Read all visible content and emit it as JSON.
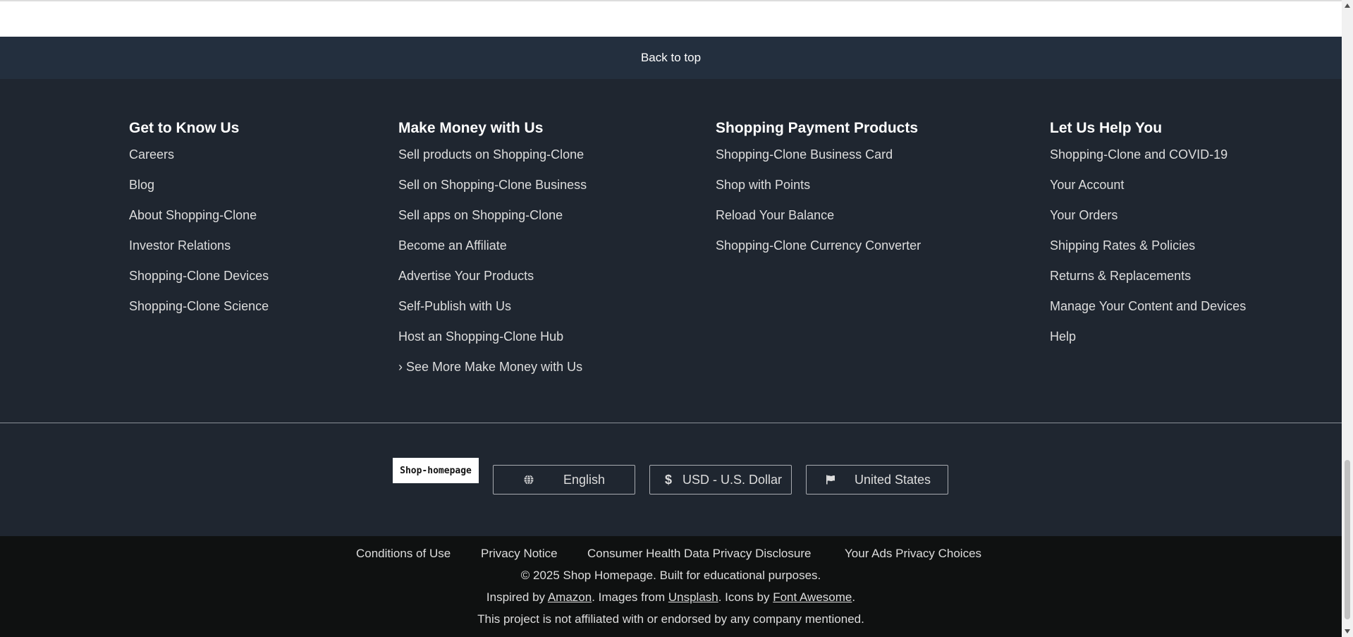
{
  "back_to_top": "Back to top",
  "columns": [
    {
      "title": "Get to Know Us",
      "links": [
        "Careers",
        "Blog",
        "About Shopping-Clone",
        "Investor Relations",
        "Shopping-Clone Devices",
        "Shopping-Clone Science"
      ]
    },
    {
      "title": "Make Money with Us",
      "links": [
        "Sell products on Shopping-Clone",
        "Sell on Shopping-Clone Business",
        "Sell apps on Shopping-Clone",
        "Become an Affiliate",
        "Advertise Your Products",
        "Self-Publish with Us",
        "Host an Shopping-Clone Hub",
        "› See More Make Money with Us"
      ]
    },
    {
      "title": "Shopping Payment Products",
      "links": [
        "Shopping-Clone Business Card",
        "Shop with Points",
        "Reload Your Balance",
        "Shopping-Clone Currency Converter"
      ]
    },
    {
      "title": "Let Us Help You",
      "links": [
        "Shopping-Clone and COVID-19",
        "Your Account",
        "Your Orders",
        "Shipping Rates & Policies",
        "Returns & Replacements",
        "Manage Your Content and Devices",
        "Help"
      ]
    }
  ],
  "logo_text": "Shop-homepage",
  "selectors": {
    "language": "English",
    "currency": "USD - U.S. Dollar",
    "country": "United States"
  },
  "legal_links": [
    "Conditions of Use",
    "Privacy Notice",
    "Consumer Health Data Privacy Disclosure",
    "Your Ads Privacy Choices"
  ],
  "copyright": "© 2025 Shop Homepage. Built for educational purposes.",
  "credits": {
    "prefix": "Inspired by ",
    "amazon": "Amazon",
    "mid1": ". Images from ",
    "unsplash": "Unsplash",
    "mid2": ". Icons by ",
    "fontawesome": "Font Awesome",
    "suffix": "."
  },
  "disclaimer": "This project is not affiliated with or endorsed by any company mentioned.",
  "icons": {
    "language": "globe-icon",
    "currency": "dollar-icon",
    "country": "flag-icon"
  },
  "colors": {
    "back_to_top_bg": "#232f3e",
    "footer_bg": "#1f2630",
    "bottom_bg": "#0f1111"
  }
}
